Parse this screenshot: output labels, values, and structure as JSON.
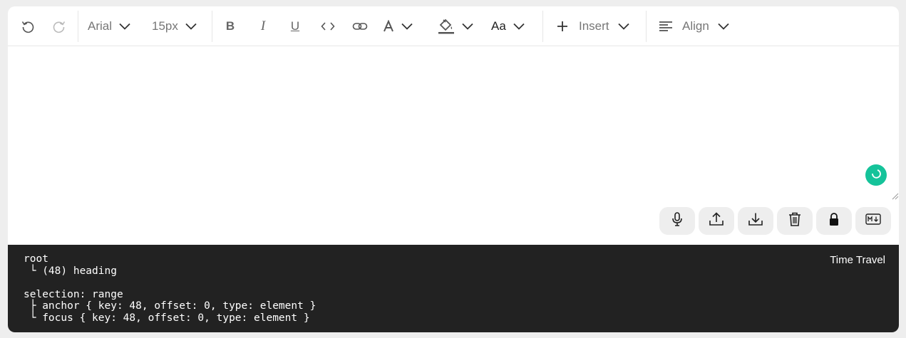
{
  "toolbar": {
    "undo_icon": "undo-icon",
    "redo_icon": "redo-icon",
    "font_family": "Arial",
    "font_size": "15px",
    "bold_label": "B",
    "italic_label": "I",
    "underline_label": "U",
    "case_label": "Aa",
    "insert_label": "Insert",
    "align_label": "Align"
  },
  "actions": [
    "microphone-icon",
    "upload-icon",
    "download-icon",
    "trash-icon",
    "lock-icon",
    "markdown-icon"
  ],
  "tree_view": {
    "lines": "root\n └ (48) heading\n\nselection: range\n ├ anchor { key: 48, offset: 0, type: element }\n └ focus { key: 48, offset: 0, type: element }",
    "time_travel_label": "Time Travel"
  },
  "colors": {
    "background": "#eeeeee",
    "tree_bg": "#222222",
    "grammarly_green": "#15c39a"
  }
}
